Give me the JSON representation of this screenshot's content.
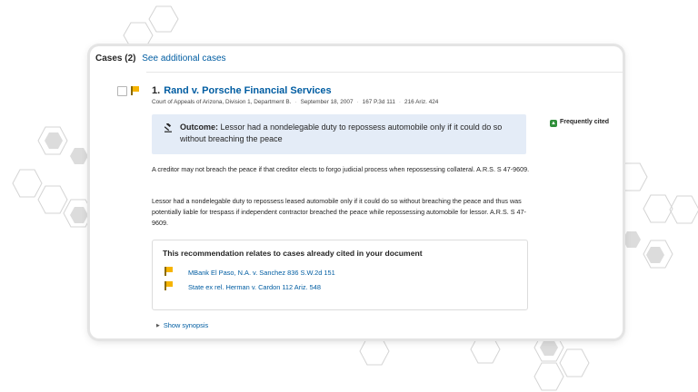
{
  "header": {
    "title": "Cases (2)",
    "link": "See additional cases"
  },
  "case": {
    "number": "1.",
    "name": "Rand v. Porsche Financial Services",
    "court": "Court of Appeals of Arizona, Division 1, Department B.",
    "date": "September 18, 2007",
    "cite1": "167 P.3d 111",
    "cite2": "216 Ariz. 424",
    "badge": "Frequently cited",
    "outcome_label": "Outcome:",
    "outcome_text": "Lessor had a nondelegable duty to repossess automobile only if it could do so without breaching the peace",
    "paragraph1": "A creditor may not breach the peace if that creditor elects to forgo judicial process when repossessing collateral. A.R.S. S 47-9609.",
    "paragraph2": "Lessor had a nondelegable duty to repossess leased automobile only if it could do so without breaching the peace and thus was potentially liable for trespass if independent contractor breached the peace while repossessing automobile for lessor. A.R.S. S 47-9609."
  },
  "recommendation": {
    "title": "This recommendation relates to cases already cited in your document",
    "items": [
      "MBank El Paso, N.A. v. Sanchez 836 S.W.2d 151",
      "State ex rel. Herman v. Cardon 112 Ariz. 548"
    ]
  },
  "show_synopsis": "Show synopsis",
  "colors": {
    "link": "#005da2",
    "outcome_bg": "#e4ecf7",
    "flag": "#f6b400",
    "frequently_cited_icon": "#2f8f3a"
  },
  "icons": [
    "checkbox-icon",
    "flag-icon",
    "gavel-icon",
    "frequently-cited-icon",
    "triangle-right-icon"
  ]
}
